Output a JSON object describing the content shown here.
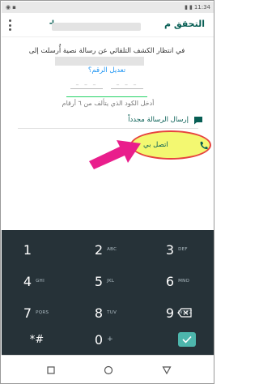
{
  "status_bar": {
    "time": "11:34"
  },
  "header": {
    "title": "التحقق م",
    "plus": "+"
  },
  "message": {
    "text": "في انتظار الكشف التلقائي عن رسالة نصية أُرسلت إلى",
    "edit_link": "تعديل الرقم؟"
  },
  "code_input": {
    "placeholder_left": "– – –",
    "placeholder_right": "– – –",
    "hint": "أدخل الكود الذي يتألف من ٦ أرقام"
  },
  "actions": {
    "resend_sms": "إرسال الرسالة مجدداً",
    "call_me": "اتصل بي"
  },
  "colors": {
    "accent": "#075e54",
    "link": "#2196f3",
    "highlight": "#f3f86a",
    "arrow": "#e91e8c",
    "keyboard_bg": "#263238",
    "done": "#4db6ac"
  },
  "keyboard": {
    "rows": [
      [
        {
          "digit": "1",
          "letters": ""
        },
        {
          "digit": "2",
          "letters": "ABC"
        },
        {
          "digit": "3",
          "letters": "DEF"
        }
      ],
      [
        {
          "digit": "4",
          "letters": "GHI"
        },
        {
          "digit": "5",
          "letters": "JKL"
        },
        {
          "digit": "6",
          "letters": "MNO"
        }
      ],
      [
        {
          "digit": "7",
          "letters": "PQRS"
        },
        {
          "digit": "8",
          "letters": "TUV"
        },
        {
          "digit": "9",
          "letters": "WXYZ"
        }
      ],
      [
        {
          "digit": "*#",
          "letters": ""
        },
        {
          "digit": "0",
          "letters": "+"
        },
        {
          "digit": "",
          "letters": ""
        }
      ]
    ],
    "backspace_icon": "backspace-icon",
    "done_icon": "check-icon"
  },
  "nav_bar": {
    "icons": [
      "recents-square-icon",
      "home-circle-icon",
      "back-triangle-icon"
    ]
  }
}
